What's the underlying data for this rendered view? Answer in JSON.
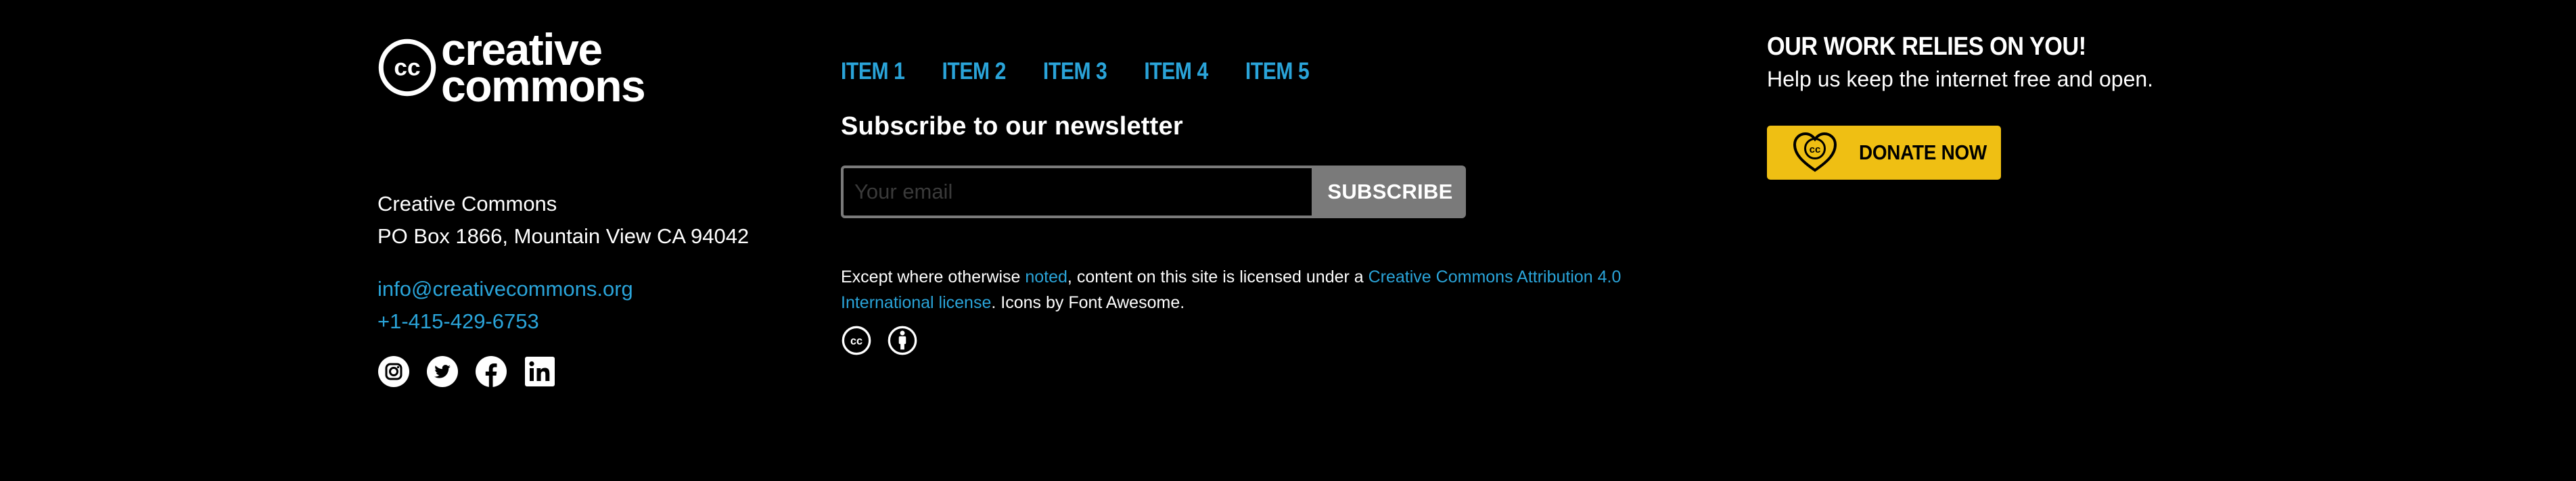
{
  "brand": {
    "logo_line1": "creative",
    "logo_line2": "commons",
    "logo_badge": "cc"
  },
  "address": {
    "name": "Creative Commons",
    "street": "PO Box 1866, Mountain View CA 94042"
  },
  "contact": {
    "email": "info@creativecommons.org",
    "phone": "+1-415-429-6753"
  },
  "social": [
    "instagram-icon",
    "twitter-icon",
    "facebook-icon",
    "linkedin-icon"
  ],
  "nav": {
    "items": [
      "ITEM 1",
      "ITEM 2",
      "ITEM 3",
      "ITEM 4",
      "ITEM 5"
    ]
  },
  "newsletter": {
    "title": "Subscribe to our newsletter",
    "placeholder": "Your email",
    "button": "SUBSCRIBE"
  },
  "license": {
    "prefix": "Except where otherwise ",
    "noted": "noted",
    "middle": ", content on this site is licensed under a ",
    "license_link": "Creative Commons Attribution 4.0 International license",
    "suffix": ". Icons by Font Awesome.",
    "icons": [
      "cc-icon",
      "attribution-icon"
    ]
  },
  "support": {
    "title": "OUR WORK RELIES ON YOU!",
    "subtitle": "Help us keep the internet free and open.",
    "donate": "DONATE NOW"
  },
  "colors": {
    "background": "#000000",
    "link": "#2aa4d9",
    "donate": "#efbf13",
    "button_gray": "#7a7a7a"
  }
}
